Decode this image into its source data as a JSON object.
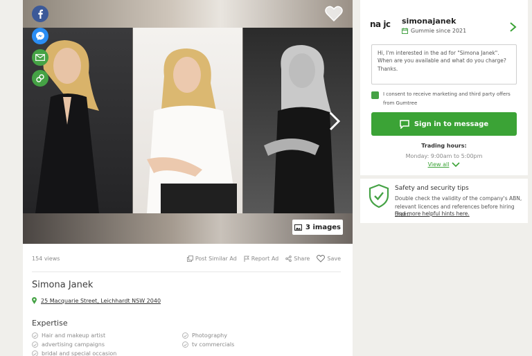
{
  "gallery": {
    "images_count_label": "3 images",
    "share_buttons": [
      "facebook-icon",
      "messenger-icon",
      "email-icon",
      "link-icon"
    ]
  },
  "ad": {
    "views": "154 views",
    "actions": {
      "post_similar": "Post Similar Ad",
      "report": "Report Ad",
      "share": "Share",
      "save": "Save"
    },
    "title": "Simona Janek",
    "address": "25 Macquarie Street, Leichhardt NSW 2040",
    "expertise_heading": "Expertise",
    "expertise_left": [
      "Hair and makeup artist",
      "advertising campaigns",
      "bridal and special occasion"
    ],
    "expertise_right": [
      "Photography",
      "tv commercials"
    ]
  },
  "seller": {
    "logo_text": "na jc",
    "name": "simonajanek",
    "since": "Gummie since 2021",
    "message": "Hi, I'm interested in the ad for \"Simona Janek\". When are you available and what do you charge? Thanks.",
    "consent": "I consent to receive marketing and third party offers from Gumtree",
    "sign_in_label": "Sign in to message",
    "trading_title": "Trading hours:",
    "trading_hours": "Monday: 9:00am to 5:00pm",
    "view_all": "View all"
  },
  "safety": {
    "title": "Safety and security tips",
    "text": "Double check the validity of the company's ABN, relevant licences and references before hiring them.",
    "link": "Find more helpful hints here."
  },
  "colors": {
    "accent_green": "#3ba336",
    "facebook": "#3b5998",
    "messenger": "#2a8df3",
    "page_bg": "#f0efeb"
  }
}
